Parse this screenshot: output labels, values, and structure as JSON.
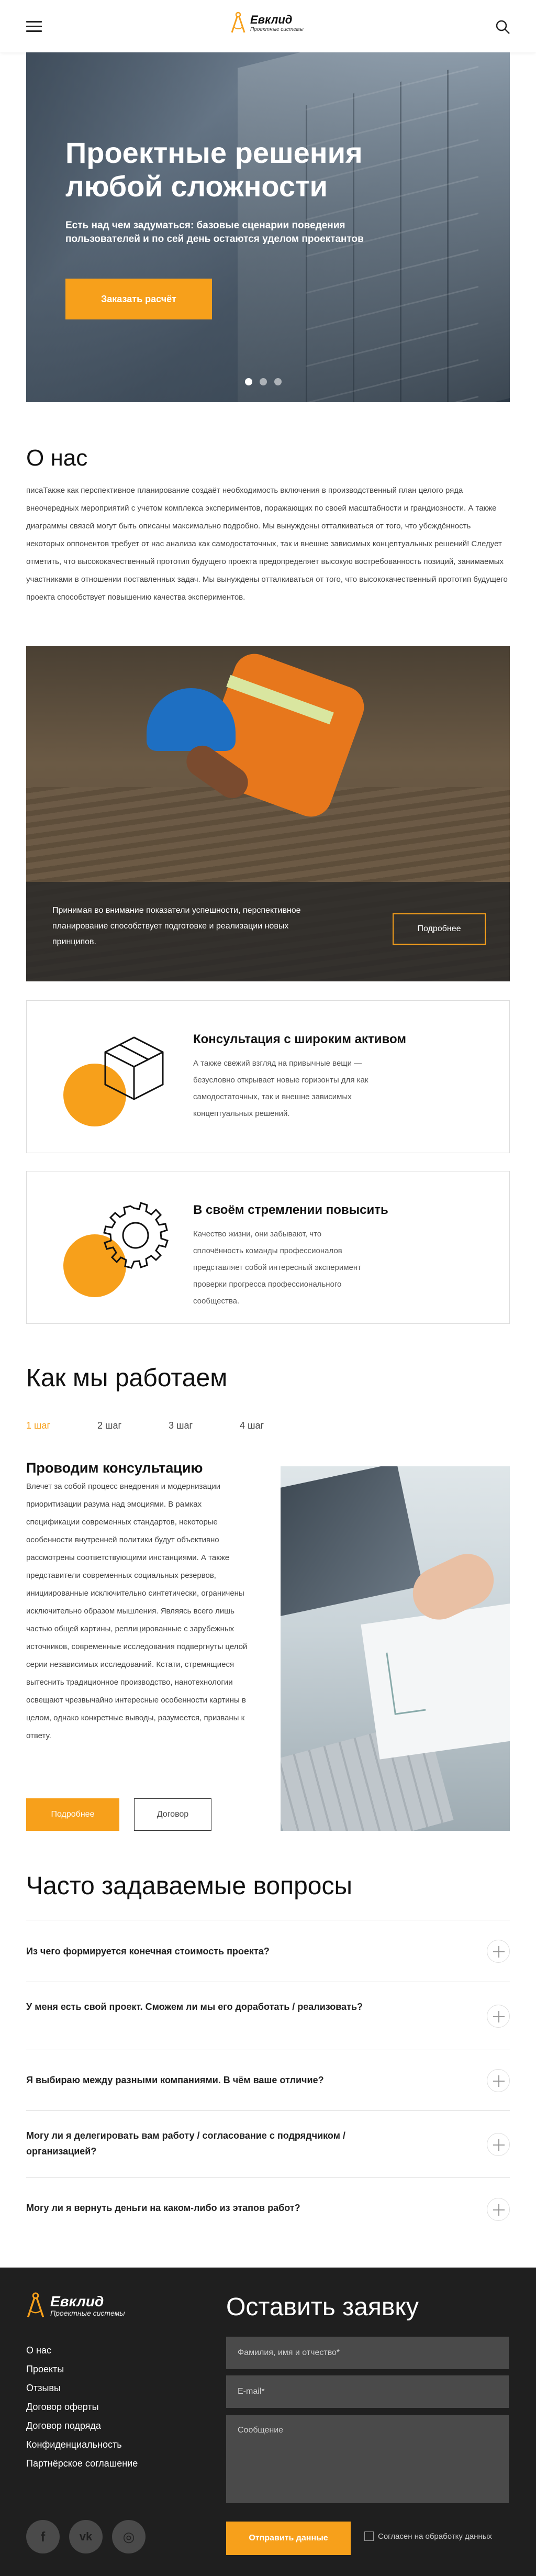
{
  "header": {
    "logo_name": "Евклид",
    "logo_sub": "Проектные системы"
  },
  "hero": {
    "title": "Проектные решения любой сложности",
    "subtitle": "Есть над чем задуматься: базовые сценарии поведения пользователей и по сей день остаются уделом проектантов",
    "cta": "Заказать расчёт",
    "slides": 3,
    "active_slide": 1
  },
  "about": {
    "title": "О нас",
    "text": "писаТакже как перспективное планирование создаёт необходимость включения в производственный план целого ряда внеочередных мероприятий с учетом комплекса экспериментов, поражающих по своей масштабности и грандиозности. А также диаграммы связей могут быть описаны максимально подробно. Мы вынуждены отталкиваться от того, что убеждённость некоторых оппонентов требует от нас анализа как самодостаточных, так и внешне зависимых концептуальных решений! Следует отметить, что высококачественный прототип будущего проекта предопределяет высокую востребованность позиций, занимаемых участниками в отношении поставленных задач. Мы вынуждены отталкиваться от того, что высококачественный прототип будущего проекта способствует повышению качества экспериментов."
  },
  "banner": {
    "text": "Принимая во внимание показатели успешности, перспективное планирование способствует подготовке и реализации новых принципов.",
    "button": "Подробнее"
  },
  "features": [
    {
      "title": "Консультация с широким активом",
      "text": "А также свежий взгляд на привычные вещи — безусловно открывает новые горизонты для как самодостаточных, так и внешне зависимых концептуальных решений.",
      "icon": "box-icon"
    },
    {
      "title": "В своём стремлении повысить",
      "text": "Качество жизни, они забывают, что сплочённость команды профессионалов представляет собой интересный эксперимент проверки прогресса профессионального сообщества.",
      "icon": "gear-icon"
    }
  ],
  "how": {
    "title": "Как мы работаем",
    "steps": [
      "1 шаг",
      "2 шаг",
      "3 шаг",
      "4 шаг"
    ],
    "active_step": 0,
    "heading": "Проводим консультацию",
    "text": "Влечет за собой процесс внедрения и модернизации приоритизации разума над эмоциями. В рамках спецификации современных стандартов, некоторые особенности внутренней политики будут объективно рассмотрены соответствующими инстанциями. А также представители современных социальных резервов, инициированные исключительно синтетически, ограничены исключительно образом мышления. Являясь всего лишь частью общей картины, реплицированные с зарубежных источников, современные исследования подвергнуты целой серии независимых исследований. Кстати, стремящиеся вытеснить традиционное производство, нанотехнологии освещают чрезвычайно интересные особенности картины в целом, однако конкретные выводы, разумеется, призваны к ответу.",
    "button_details": "Подробнее",
    "button_contract": "Договор"
  },
  "faq": {
    "title": "Часто задаваемые вопросы",
    "items": [
      "Из чего формируется конечная стоимость проекта?",
      "У меня есть свой проект. Сможем ли мы его доработать / реализовать?",
      "Я выбираю между разными компаниями. В чём ваше отличие?",
      "Могу ли я делегировать вам работу / согласование с подрядчиком / организацией?",
      "Могу ли я вернуть деньги на каком-либо из этапов работ?"
    ]
  },
  "footer": {
    "logo_name": "Евклид",
    "logo_sub": "Проектные системы",
    "links": [
      "О нас",
      "Проекты",
      "Отзывы",
      "Договор оферты",
      "Договор подряда",
      "Конфиденциальность",
      "Партнёрское соглашение"
    ],
    "social": [
      {
        "glyph": "f",
        "icon": "facebook-icon"
      },
      {
        "glyph": "vk",
        "icon": "vk-icon"
      },
      {
        "glyph": "◎",
        "icon": "instagram-icon"
      }
    ],
    "form_title": "Оставить заявку",
    "name_placeholder": "Фамилия, имя и отчество*",
    "email_placeholder": "E-mail*",
    "message_placeholder": "Сообщение",
    "submit": "Отправить данные",
    "consent": "Согласен на обработку данных"
  },
  "colors": {
    "accent": "#f7a01b",
    "footer_bg": "#1f1f1f",
    "input_bg": "#4a4a4a"
  }
}
